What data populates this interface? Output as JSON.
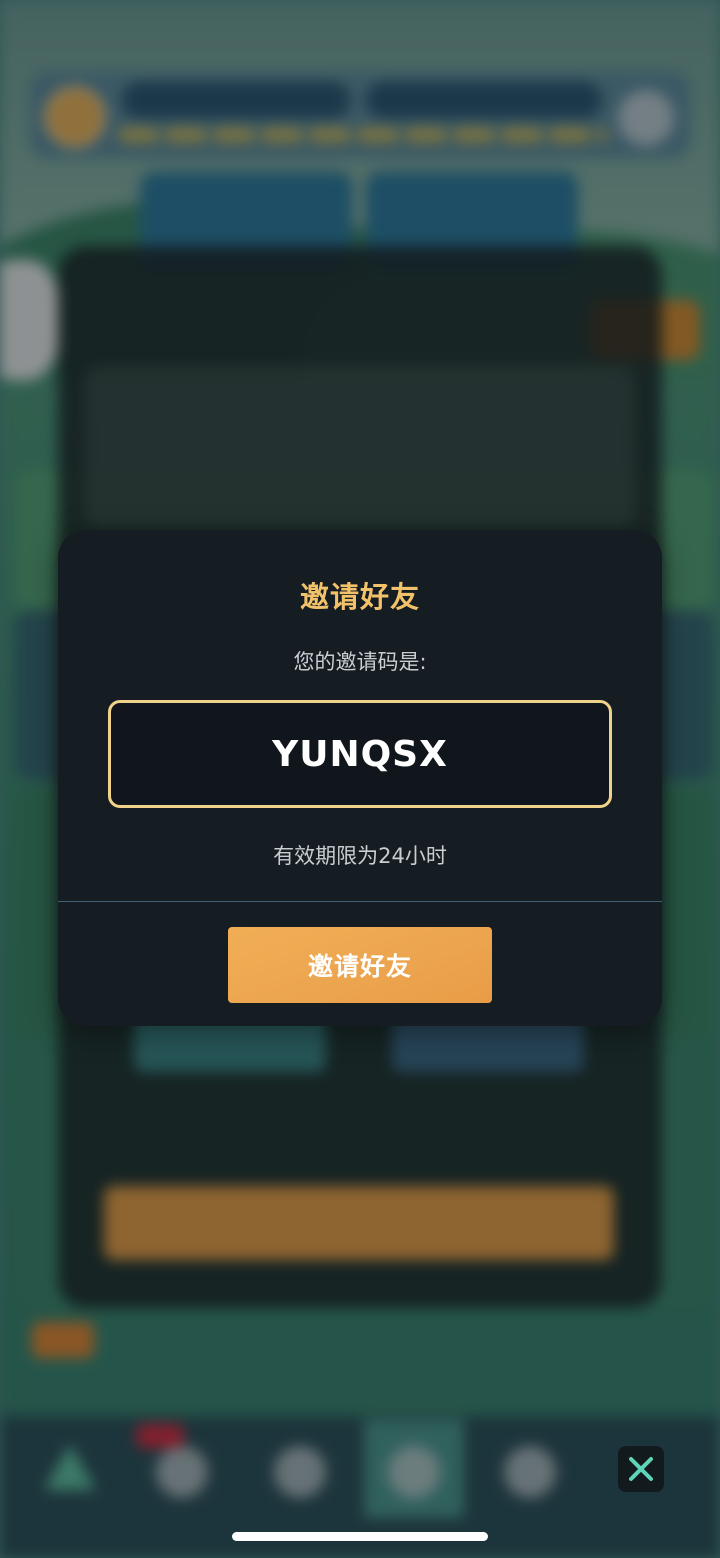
{
  "modal": {
    "title": "邀请好友",
    "subtitle": "您的邀请码是:",
    "invite_code": "YUNQSX",
    "validity": "有效期限为24小时",
    "button_label": "邀请好友"
  },
  "colors": {
    "title": "#f2c26a",
    "code_border": "#f0d38a",
    "button": "#eda650",
    "modal_bg": "#151c22"
  },
  "icons": {
    "close": "close-icon"
  }
}
